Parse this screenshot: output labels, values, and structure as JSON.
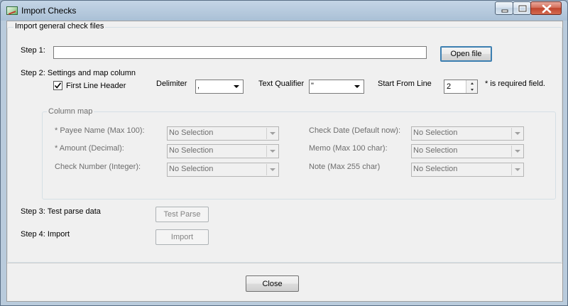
{
  "window": {
    "title": "Import Checks"
  },
  "main_group": {
    "legend": "Import general check files",
    "step1": {
      "label": "Step 1:",
      "file_path": "",
      "open_button": "Open file"
    },
    "step2": {
      "label": "Step 2:  Settings and map column",
      "first_line_header": {
        "label": "First Line Header",
        "checked": true
      },
      "delimiter": {
        "label": "Delimiter",
        "value": ","
      },
      "text_qualifier": {
        "label": "Text Qualifier",
        "value": "\""
      },
      "start_from_line": {
        "label": "Start From Line",
        "value": "2"
      },
      "required_note": "* is required field."
    },
    "column_map": {
      "legend": "Column map",
      "left": [
        {
          "label": "* Payee Name (Max 100):",
          "value": "No Selection"
        },
        {
          "label": "* Amount (Decimal):",
          "value": "No Selection"
        },
        {
          "label": "Check Number (Integer):",
          "value": "No Selection"
        }
      ],
      "right": [
        {
          "label": "Check Date (Default now):",
          "value": "No Selection"
        },
        {
          "label": "Memo (Max 100 char):",
          "value": "No Selection"
        },
        {
          "label": "Note  (Max 255 char)",
          "value": "No Selection"
        }
      ]
    },
    "step3": {
      "label": "Step 3: Test parse data",
      "button": "Test Parse"
    },
    "step4": {
      "label": "Step 4: Import",
      "button": "Import"
    }
  },
  "footer": {
    "close_button": "Close"
  },
  "icons": {
    "app": "import-checks-icon",
    "minimize": "minimize-icon",
    "maximize": "maximize-icon",
    "close": "close-icon",
    "dropdown": "chevron-down-icon",
    "checkmark": "checkmark-icon"
  }
}
